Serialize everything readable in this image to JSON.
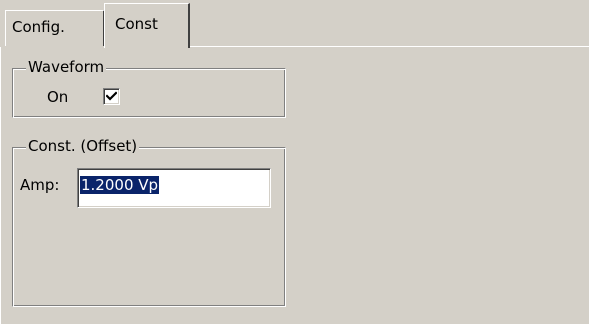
{
  "tabs": [
    {
      "label": "Config.",
      "selected": false
    },
    {
      "label": "Const",
      "selected": true
    }
  ],
  "waveform": {
    "legend": "Waveform",
    "on_label": "On",
    "on_checked": true
  },
  "const": {
    "legend": "Const. (Offset)",
    "amp_label": "Amp:",
    "amp_value": "1.2000 Vp",
    "amp_selected": true
  },
  "colors": {
    "face": "#d4d0c8",
    "selection": "#0a246a",
    "selection_text": "#ffffff"
  },
  "icons": {
    "checkbox_mark": "check-icon"
  }
}
